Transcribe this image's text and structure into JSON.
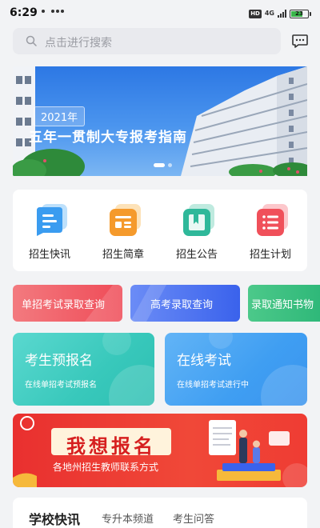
{
  "status_bar": {
    "time": "6:29",
    "hd_badge": "HD",
    "network": "4G",
    "battery": "23"
  },
  "search": {
    "placeholder": "点击进行搜索",
    "icon": "search-icon",
    "message_icon": "message-icon"
  },
  "banner": {
    "year": "2021年",
    "title": "五年一贯制大专报考指南",
    "slide_count": 2,
    "active_slide": 1
  },
  "quick_links": [
    {
      "label": "招生快讯",
      "icon": "news-flash-icon",
      "color": "#3a9cf0"
    },
    {
      "label": "招生简章",
      "icon": "brochure-icon",
      "color": "#f59a2c"
    },
    {
      "label": "招生公告",
      "icon": "announcement-icon",
      "color": "#2fb89a"
    },
    {
      "label": "招生计划",
      "icon": "plan-list-icon",
      "color": "#f0505a"
    }
  ],
  "query_buttons": [
    {
      "label": "单招考试录取查询",
      "color": "#f0525c"
    },
    {
      "label": "高考录取查询",
      "color": "#3f6ff0"
    },
    {
      "label": "录取通知书物",
      "color": "#2fb879"
    }
  ],
  "features": [
    {
      "title": "考生预报名",
      "subtitle": "在线单招考试预报名",
      "color": "#3ccfc0"
    },
    {
      "title": "在线考试",
      "subtitle": "在线单招考试进行中",
      "color": "#3f9ef2"
    }
  ],
  "recruit_banner": {
    "title": "我想报名",
    "subtitle": "各地州招生教师联系方式",
    "color": "#e9302f"
  },
  "news": {
    "title": "学校快讯",
    "tabs": [
      "专升本频道",
      "考生问答"
    ]
  }
}
